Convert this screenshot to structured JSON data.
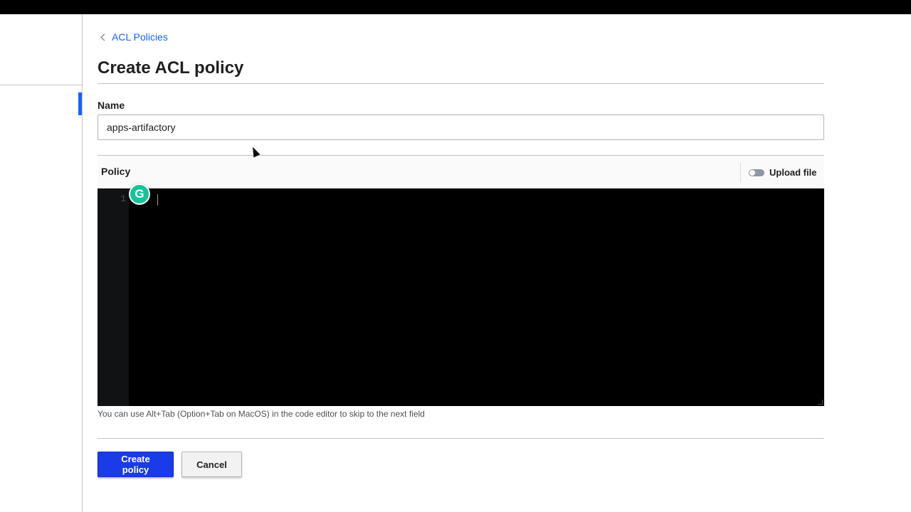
{
  "breadcrumb": {
    "label": "ACL Policies"
  },
  "page": {
    "title": "Create ACL policy"
  },
  "form": {
    "name_label": "Name",
    "name_value": "apps-artifactory",
    "policy_label": "Policy",
    "upload_label": "Upload file",
    "upload_enabled": false,
    "editor_line_number": "1",
    "help_text": "You can use Alt+Tab (Option+Tab on MacOS) in the code editor to skip to the next field"
  },
  "actions": {
    "create_label": "Create policy",
    "cancel_label": "Cancel"
  },
  "overlay": {
    "grammarly_glyph": "G"
  },
  "colors": {
    "accent": "#1563ff",
    "primary_button": "#1a3be8",
    "editor_background": "#000000",
    "grammarly": "#15c39a"
  },
  "icons": {
    "breadcrumb": "chevron-left-icon",
    "toggle": "toggle-off-icon",
    "grammarly": "grammarly-icon",
    "pointer": "mouse-pointer-icon"
  }
}
